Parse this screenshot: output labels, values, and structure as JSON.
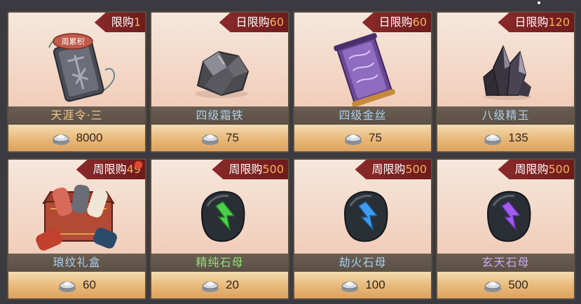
{
  "shop": {
    "items": [
      {
        "limit_prefix": "限购",
        "limit_count": "1",
        "name": "天涯令·三",
        "name_color": "#f1c889",
        "price": "8000",
        "badge": "周累积",
        "icon": "jade-token-icon",
        "notification": false
      },
      {
        "limit_prefix": "日限购",
        "limit_count": "60",
        "name": "四级霜铁",
        "name_color": "#a9d0ee",
        "price": "75",
        "icon": "frost-iron-ore-icon",
        "notification": false
      },
      {
        "limit_prefix": "日限购",
        "limit_count": "60",
        "name": "四级金丝",
        "name_color": "#a9d0ee",
        "price": "75",
        "icon": "gold-silk-scroll-icon",
        "notification": false
      },
      {
        "limit_prefix": "日限购",
        "limit_count": "120",
        "name": "八级精玉",
        "name_color": "#a9d0ee",
        "price": "135",
        "icon": "refined-jade-crystal-icon",
        "notification": false
      },
      {
        "limit_prefix": "周限购",
        "limit_count": "49",
        "name": "琅纹礼盒",
        "name_color": "#a9d0ee",
        "price": "60",
        "icon": "rune-gift-box-icon",
        "notification": true
      },
      {
        "limit_prefix": "周限购",
        "limit_count": "500",
        "name": "精纯石母",
        "name_color": "#8fe07a",
        "price": "20",
        "icon": "green-arrow-stone-icon",
        "notification": false
      },
      {
        "limit_prefix": "周限购",
        "limit_count": "500",
        "name": "劫火石母",
        "name_color": "#a9d0ee",
        "price": "100",
        "icon": "blue-arrow-stone-icon",
        "notification": false
      },
      {
        "limit_prefix": "周限购",
        "limit_count": "500",
        "name": "玄天石母",
        "name_color": "#cfa9f2",
        "price": "500",
        "icon": "purple-arrow-stone-icon",
        "notification": false
      }
    ],
    "currency_icon": "silver-ingot-icon",
    "colors": {
      "tag_bg": "#7a2224",
      "tag_count": "#f6b35b",
      "card_bg": "#f2d2c0",
      "name_bar": "#5f5449",
      "price_bar": "#e8b877"
    }
  }
}
